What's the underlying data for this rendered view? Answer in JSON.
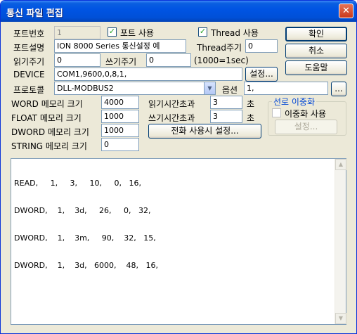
{
  "window": {
    "title": "통신 파일 편집",
    "close_symbol": "✕"
  },
  "port": {
    "number_label": "포트번호",
    "number_value": "1",
    "use_label": "포트 사용",
    "use_check": "✓",
    "thread_use_label": "Thread 사용",
    "thread_use_check": "✓",
    "desc_label": "포트설명",
    "desc_value": "ION 8000 Series 통신설정 예",
    "thread_period_label": "Thread주기",
    "thread_period_value": "0",
    "read_period_label": "읽기주기",
    "read_period_value": "0",
    "write_period_label": "쓰기주기",
    "write_period_value": "0",
    "period_unit": "(1000=1sec)",
    "device_label": "DEVICE",
    "device_value": "COM1,9600,0,8,1,",
    "device_setup_button": "설정...",
    "protocol_label": "프로토콜",
    "protocol_value": "DLL-MODBUS2",
    "option_label": "옵션",
    "option_value": "1,",
    "option_more_button": "..."
  },
  "memory": {
    "word_label": "WORD 메모리 크기",
    "word_value": "4000",
    "float_label": "FLOAT 메모리 크기",
    "float_value": "1000",
    "dword_label": "DWORD 메모리 크기",
    "dword_value": "1000",
    "string_label": "STRING 메모리 크기",
    "string_value": "0"
  },
  "timeouts": {
    "read_label": "읽기시간초과",
    "read_value": "3",
    "read_unit": "초",
    "write_label": "쓰기시간초과",
    "write_value": "3",
    "write_unit": "초",
    "phone_button": "전화 사용시 설정..."
  },
  "redundancy": {
    "group_title": "선로 이중화",
    "use_label": "이중화 사용",
    "setup_button": "설정..."
  },
  "buttons": {
    "ok": "확인",
    "cancel": "취소",
    "help": "도움말"
  },
  "editor_lines": [
    "READ,     1,     3,     10,     0,   16,",
    "DWORD,    1,    3d,     26,     0,   32,",
    "DWORD,    1,    3m,     90,    32,   15,",
    "DWORD,    1,    3d,   6000,    48,   16,"
  ],
  "scroll": {
    "up": "▲",
    "down": "▼"
  }
}
